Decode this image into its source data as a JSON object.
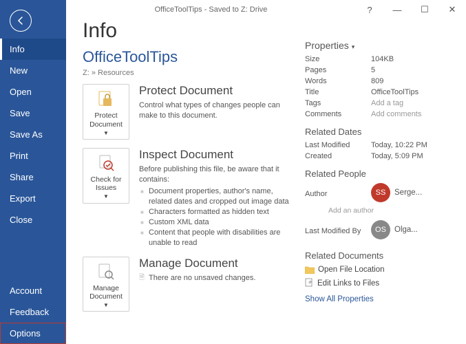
{
  "titlebar": {
    "text": "OfficeToolTips  -  Saved to Z: Drive",
    "help": "?",
    "minimize": "—",
    "maximize": "☐",
    "close": "✕"
  },
  "nav": {
    "items": [
      "Info",
      "New",
      "Open",
      "Save",
      "Save As",
      "Print",
      "Share",
      "Export",
      "Close"
    ],
    "bottom": [
      "Account",
      "Feedback",
      "Options"
    ]
  },
  "page": {
    "title": "Info",
    "doc_name": "OfficeToolTips",
    "path": "Z: » Resources"
  },
  "protect": {
    "btn": "Protect Document",
    "title": "Protect Document",
    "desc": "Control what types of changes people can make to this document."
  },
  "inspect": {
    "btn": "Check for Issues",
    "title": "Inspect Document",
    "desc": "Before publishing this file, be aware that it contains:",
    "items": [
      "Document properties, author's name, related dates and cropped out image data",
      "Characters formatted as hidden text",
      "Custom XML data",
      "Content that people with disabilities are unable to read"
    ]
  },
  "manage": {
    "btn": "Manage Document",
    "title": "Manage Document",
    "desc": "There are no unsaved changes."
  },
  "props": {
    "header": "Properties",
    "rows": {
      "size_k": "Size",
      "size_v": "104KB",
      "pages_k": "Pages",
      "pages_v": "5",
      "words_k": "Words",
      "words_v": "809",
      "title_k": "Title",
      "title_v": "OfficeToolTips",
      "tags_k": "Tags",
      "tags_v": "Add a tag",
      "comments_k": "Comments",
      "comments_v": "Add comments"
    }
  },
  "dates": {
    "header": "Related Dates",
    "mod_k": "Last Modified",
    "mod_v": "Today, 10:22 PM",
    "created_k": "Created",
    "created_v": "Today,   5:09 PM"
  },
  "people": {
    "header": "Related People",
    "author_k": "Author",
    "author_initials": "SS",
    "author_name": "Serge...",
    "add_author": "Add an author",
    "modby_k": "Last Modified By",
    "modby_initials": "OS",
    "modby_name": "Olga..."
  },
  "docs": {
    "header": "Related Documents",
    "open_loc": "Open File Location",
    "edit_links": "Edit Links to Files",
    "show_all": "Show All Properties"
  }
}
